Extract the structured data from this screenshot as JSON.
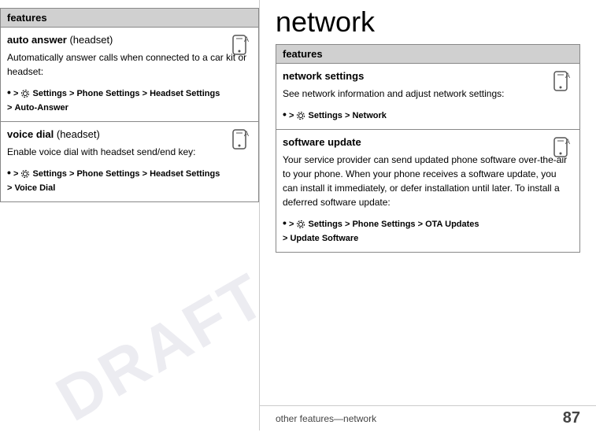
{
  "page": {
    "title": "network",
    "footer": {
      "left": "other features—network",
      "right": "87"
    },
    "watermark": "DRAFT"
  },
  "left": {
    "header": "features",
    "rows": [
      {
        "id": "auto-answer",
        "title_bold": "auto answer",
        "title_normal": " (headset)",
        "desc": "Automatically answer calls when connected to a car kit or headset:",
        "nav": "• > ⚙ Settings > Phone Settings > Headset Settings > Auto-Answer",
        "has_icon": true
      },
      {
        "id": "voice-dial",
        "title_bold": "voice dial",
        "title_normal": " (headset)",
        "desc": "Enable voice dial with headset send/end key:",
        "nav": "• > ⚙ Settings > Phone Settings > Headset Settings > Voice Dial",
        "has_icon": true
      }
    ]
  },
  "right": {
    "header": "features",
    "rows": [
      {
        "id": "network-settings",
        "title": "network settings",
        "desc": "See network information and adjust network settings:",
        "nav": "• > ⚙ Settings > Network",
        "has_icon": true
      },
      {
        "id": "software-update",
        "title": "software update",
        "desc": "Your service provider can send updated phone software over-the-air to your phone. When your phone receives a software update, you can install it immediately, or defer installation until later. To install a deferred software update:",
        "nav": "• > ⚙ Settings > Phone Settings > OTA Updates > Update Software",
        "has_icon": true
      }
    ]
  }
}
